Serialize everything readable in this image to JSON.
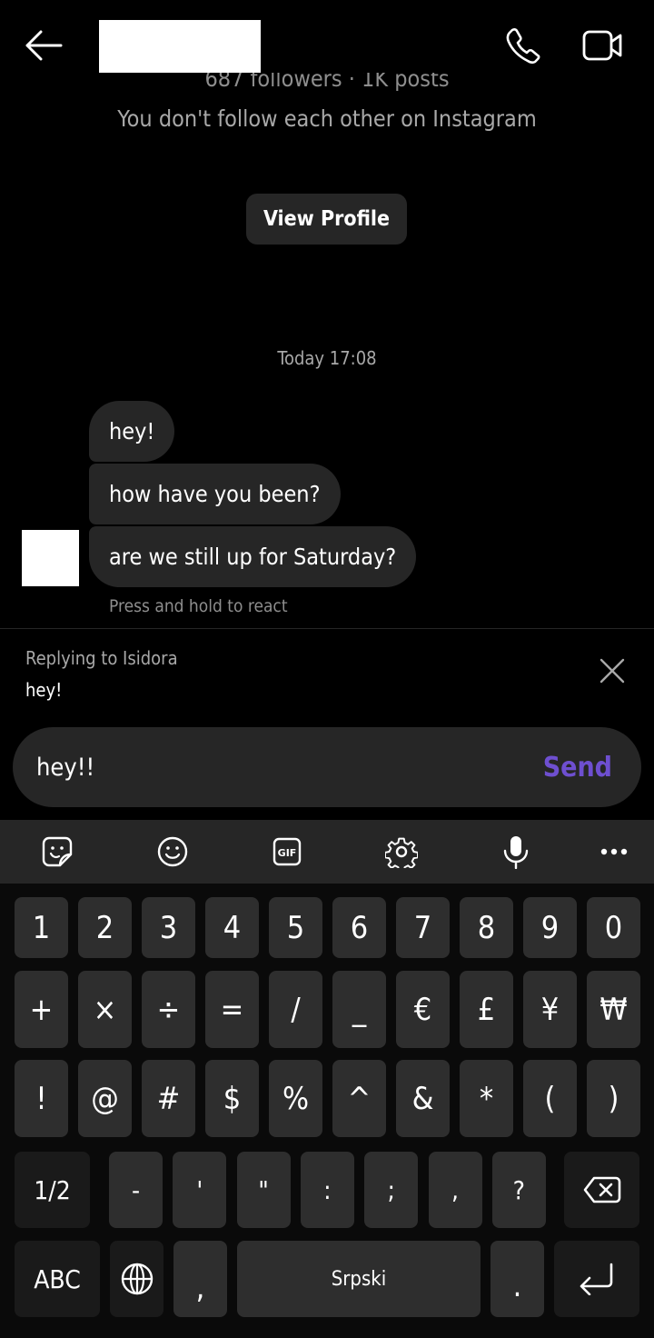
{
  "header": {
    "back_icon": "arrow-left-icon",
    "title_redacted": true,
    "call_icon": "phone-icon",
    "video_icon": "video-camera-icon"
  },
  "profile": {
    "stats_partial": "687 followers · 1K posts",
    "follow_note": "You don't follow each other on Instagram",
    "view_profile_label": "View Profile"
  },
  "conversation": {
    "timestamp": "Today 17:08",
    "messages": [
      {
        "text": "hey!"
      },
      {
        "text": "how have you been?"
      },
      {
        "text": "are we still up for Saturday?"
      }
    ],
    "react_hint": "Press and hold to react"
  },
  "reply": {
    "label": "Replying to Isidora",
    "quoted_text": "hey!",
    "close_icon": "close-icon"
  },
  "composer": {
    "value": "hey!!",
    "send_label": "Send",
    "send_color": "#6e4fd0"
  },
  "keyboard": {
    "toolbar": [
      {
        "name": "sticker-icon"
      },
      {
        "name": "emoji-icon"
      },
      {
        "name": "gif-icon",
        "label": "GIF"
      },
      {
        "name": "settings-icon"
      },
      {
        "name": "microphone-icon"
      },
      {
        "name": "more-icon"
      }
    ],
    "row1": [
      "1",
      "2",
      "3",
      "4",
      "5",
      "6",
      "7",
      "8",
      "9",
      "0"
    ],
    "row2": [
      "+",
      "×",
      "÷",
      "=",
      "/",
      "_",
      "€",
      "£",
      "¥",
      "₩"
    ],
    "row3": [
      "!",
      "@",
      "#",
      "$",
      "%",
      "^",
      "&",
      "*",
      "(",
      ")"
    ],
    "row4": {
      "page_label": "1/2",
      "keys": [
        "-",
        "'",
        "\"",
        ":",
        ";",
        ",",
        "?"
      ],
      "backspace_icon": "backspace-icon"
    },
    "row5": {
      "abc_label": "ABC",
      "globe_icon": "globe-icon",
      "comma": ",",
      "space_label": "Srpski",
      "period": ".",
      "enter_icon": "enter-icon"
    }
  }
}
